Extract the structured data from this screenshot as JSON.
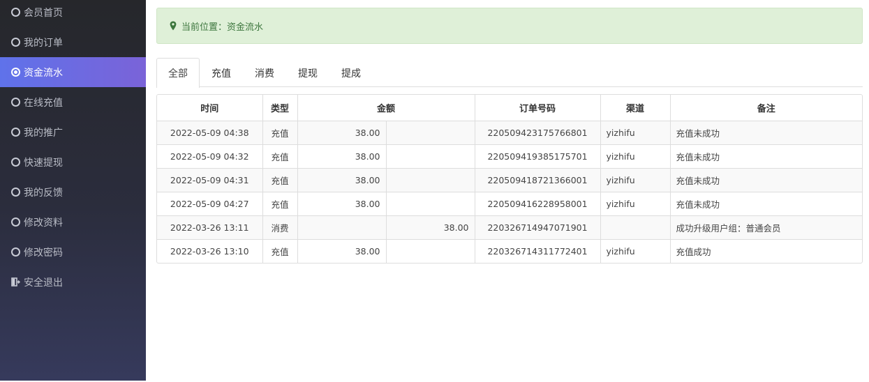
{
  "sidebar": {
    "items": [
      {
        "label": "会员首页",
        "icon": "circle-icon",
        "active": false
      },
      {
        "label": "我的订单",
        "icon": "circle-icon",
        "active": false
      },
      {
        "label": "资金流水",
        "icon": "radio-selected-icon",
        "active": true
      },
      {
        "label": "在线充值",
        "icon": "circle-icon",
        "active": false
      },
      {
        "label": "我的推广",
        "icon": "circle-icon",
        "active": false
      },
      {
        "label": "快速提现",
        "icon": "circle-icon",
        "active": false
      },
      {
        "label": "我的反馈",
        "icon": "circle-icon",
        "active": false
      },
      {
        "label": "修改资料",
        "icon": "circle-icon",
        "active": false
      },
      {
        "label": "修改密码",
        "icon": "circle-icon",
        "active": false
      },
      {
        "label": "安全退出",
        "icon": "exit-door-icon",
        "active": false
      }
    ]
  },
  "breadcrumb": {
    "text": "当前位置：资金流水",
    "icon": "map-pin-icon"
  },
  "tabs": [
    {
      "label": "全部",
      "active": true
    },
    {
      "label": "充值",
      "active": false
    },
    {
      "label": "消费",
      "active": false
    },
    {
      "label": "提现",
      "active": false
    },
    {
      "label": "提成",
      "active": false
    }
  ],
  "table": {
    "headers": {
      "time": "时间",
      "type": "类型",
      "amount": "金额",
      "order_no": "订单号码",
      "channel": "渠道",
      "remark": "备注"
    },
    "rows": [
      {
        "time": "2022-05-09 04:38",
        "type": "充值",
        "income": "38.00",
        "expense": "",
        "order_no": "220509423175766801",
        "channel": "yizhifu",
        "remark": "充值未成功"
      },
      {
        "time": "2022-05-09 04:32",
        "type": "充值",
        "income": "38.00",
        "expense": "",
        "order_no": "220509419385175701",
        "channel": "yizhifu",
        "remark": "充值未成功"
      },
      {
        "time": "2022-05-09 04:31",
        "type": "充值",
        "income": "38.00",
        "expense": "",
        "order_no": "220509418721366001",
        "channel": "yizhifu",
        "remark": "充值未成功"
      },
      {
        "time": "2022-05-09 04:27",
        "type": "充值",
        "income": "38.00",
        "expense": "",
        "order_no": "220509416228958001",
        "channel": "yizhifu",
        "remark": "充值未成功"
      },
      {
        "time": "2022-03-26 13:11",
        "type": "消费",
        "income": "",
        "expense": "38.00",
        "order_no": "220326714947071901",
        "channel": "",
        "remark": "成功升级用户组：普通会员"
      },
      {
        "time": "2022-03-26 13:10",
        "type": "充值",
        "income": "38.00",
        "expense": "",
        "order_no": "220326714311772401",
        "channel": "yizhifu",
        "remark": "充值成功"
      }
    ]
  },
  "colors": {
    "sidebar_bg": "#2b2d3d",
    "sidebar_active": "#6a6ae0",
    "breadcrumb_bg": "#dff0d8",
    "breadcrumb_text": "#3c763d"
  }
}
